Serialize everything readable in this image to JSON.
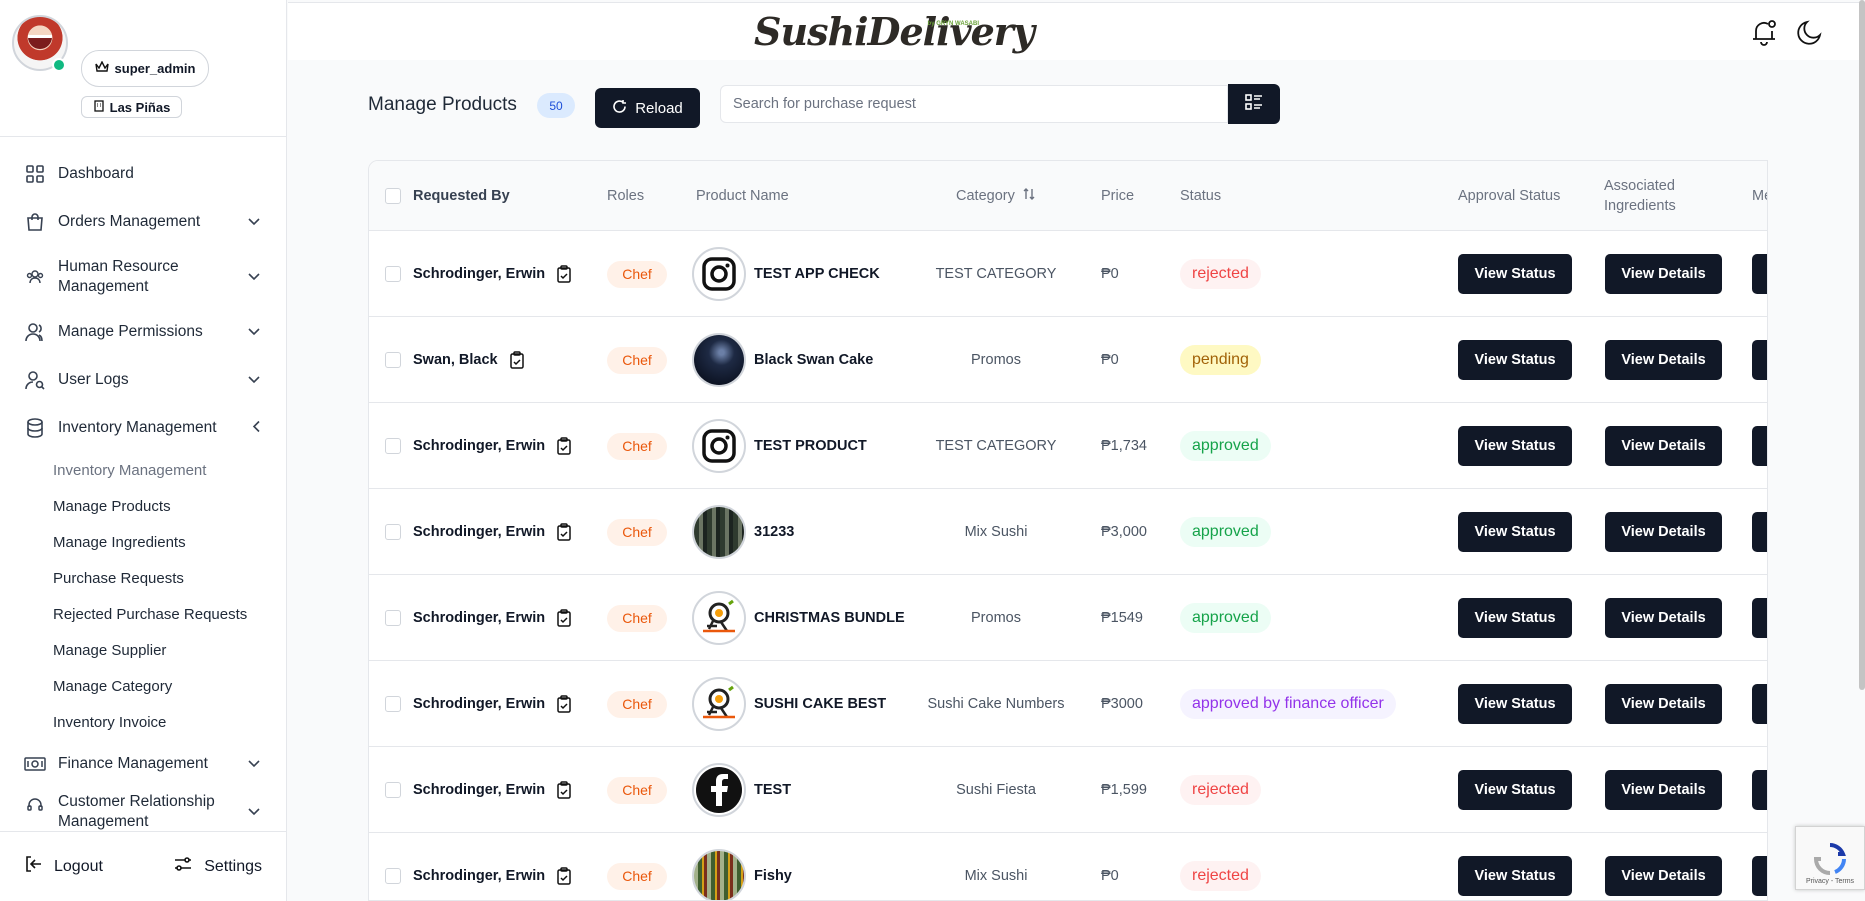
{
  "user": {
    "role": "super_admin",
    "branch": "Las Piñas"
  },
  "nav": {
    "items": [
      {
        "label": "Dashboard",
        "icon": "grid-icon"
      },
      {
        "label": "Orders Management",
        "icon": "bag-icon"
      },
      {
        "label": "Human Resource Management",
        "icon": "users-icon"
      },
      {
        "label": "Manage Permissions",
        "icon": "user-icon"
      },
      {
        "label": "User Logs",
        "icon": "user-search-icon"
      },
      {
        "label": "Inventory Management",
        "icon": "database-icon"
      },
      {
        "label": "Finance Management",
        "icon": "money-icon"
      },
      {
        "label": "Customer Relationship Management",
        "icon": "headset-icon"
      }
    ],
    "inventory_sub": [
      "Inventory Management",
      "Manage Products",
      "Manage Ingredients",
      "Purchase Requests",
      "Rejected Purchase Requests",
      "Manage Supplier",
      "Manage Category",
      "Inventory Invoice"
    ],
    "logout": "Logout",
    "settings": "Settings"
  },
  "header": {
    "logo_text": "SushiDelivery",
    "logo_sub": "by GRYN WASABI"
  },
  "toolbar": {
    "title": "Manage Products",
    "count": "50",
    "reload": "Reload",
    "search_placeholder": "Search for purchase request"
  },
  "table": {
    "headers": {
      "requested_by": "Requested By",
      "roles": "Roles",
      "product_name": "Product Name",
      "category": "Category",
      "price": "Price",
      "status": "Status",
      "approval_status": "Approval Status",
      "associated_ingredients": "Associated Ingredients",
      "more": "Me"
    },
    "view_status_label": "View Status",
    "view_details_label": "View Details",
    "rows": [
      {
        "requested_by": "Schrodinger, Erwin",
        "role": "Chef",
        "product": "TEST APP CHECK",
        "image": "instagram",
        "category": "TEST CATEGORY",
        "price": "₱0",
        "status": "rejected"
      },
      {
        "requested_by": "Swan, Black",
        "role": "Chef",
        "product": "Black Swan Cake",
        "image": "photo-dark",
        "category": "Promos",
        "price": "₱0",
        "status": "pending"
      },
      {
        "requested_by": "Schrodinger, Erwin",
        "role": "Chef",
        "product": "TEST PRODUCT",
        "image": "instagram",
        "category": "TEST CATEGORY",
        "price": "₱1,734",
        "status": "approved"
      },
      {
        "requested_by": "Schrodinger, Erwin",
        "role": "Chef",
        "product": "31233",
        "image": "photo-group",
        "category": "Mix Sushi",
        "price": "₱3,000",
        "status": "approved"
      },
      {
        "requested_by": "Schrodinger, Erwin",
        "role": "Chef",
        "product": "CHRISTMAS BUNDLE",
        "image": "logo",
        "category": "Promos",
        "price": "₱1549",
        "status": "approved"
      },
      {
        "requested_by": "Schrodinger, Erwin",
        "role": "Chef",
        "product": "SUSHI CAKE BEST",
        "image": "logo",
        "category": "Sushi Cake Numbers",
        "price": "₱3000",
        "status": "approved by finance officer"
      },
      {
        "requested_by": "Schrodinger, Erwin",
        "role": "Chef",
        "product": "TEST",
        "image": "facebook",
        "category": "Sushi Fiesta",
        "price": "₱1,599",
        "status": "rejected"
      },
      {
        "requested_by": "Schrodinger, Erwin",
        "role": "Chef",
        "product": "Fishy",
        "image": "photo-pattern",
        "category": "Mix Sushi",
        "price": "₱0",
        "status": "rejected"
      }
    ]
  },
  "recaptcha": {
    "footer": "Privacy - Terms"
  }
}
